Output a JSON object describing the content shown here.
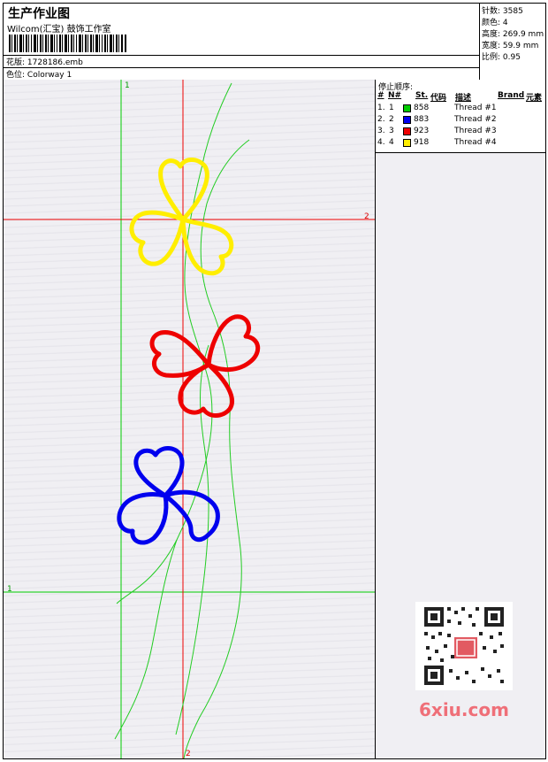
{
  "header": {
    "title": "生产作业图",
    "author": "Wilcom(汇宝) 鼓饰工作室",
    "file_label": "花版:",
    "file_name": "1728186.emb",
    "colorway_label": "色位:",
    "colorway": "Colorway 1"
  },
  "stats": [
    {
      "label": "针数:",
      "value": "3585"
    },
    {
      "label": "颜色:",
      "value": "4"
    },
    {
      "label": "高度:",
      "value": "269.9 mm"
    },
    {
      "label": "宽度:",
      "value": "59.9 mm"
    },
    {
      "label": "比例:",
      "value": "0.95"
    }
  ],
  "stop_sequence": {
    "title": "停止顺序:",
    "headers": [
      "#",
      "N#",
      "St.",
      "代码",
      "描述",
      "Brand",
      "元素"
    ],
    "rows": [
      {
        "num": "1.",
        "n": "1",
        "color": "#00cc00",
        "code": "858",
        "desc": "Thread #1"
      },
      {
        "num": "2.",
        "n": "2",
        "color": "#0000ee",
        "code": "883",
        "desc": "Thread #2"
      },
      {
        "num": "3.",
        "n": "3",
        "color": "#ee0000",
        "code": "923",
        "desc": "Thread #3"
      },
      {
        "num": "4.",
        "n": "4",
        "color": "#ffee00",
        "code": "918",
        "desc": "Thread #4"
      }
    ]
  },
  "markers": {
    "one": "1",
    "two": "2"
  },
  "watermark": {
    "logo": "6xiu.com"
  }
}
